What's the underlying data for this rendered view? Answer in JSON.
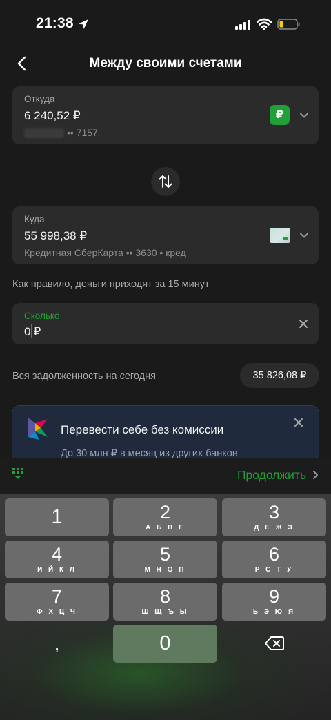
{
  "status_bar": {
    "time": "21:38"
  },
  "header": {
    "title": "Между своими счетами"
  },
  "from_account": {
    "label": "Откуда",
    "amount": "6 240,52 ₽",
    "account_suffix": "•• 7157",
    "badge": "₽"
  },
  "to_account": {
    "label": "Куда",
    "amount": "55 998,38 ₽",
    "details": "Кредитная СберКарта •• 3630 • кред"
  },
  "info_text": "Как правило, деньги приходят за 15 минут",
  "amount_input": {
    "label": "Сколько",
    "value": "0",
    "currency": "₽"
  },
  "debt": {
    "label": "Вся задолженность на сегодня",
    "value": "35 826,08 ₽"
  },
  "promo": {
    "title": "Перевести себе без комиссии",
    "subtitle": "До 30 млн ₽ в месяц из других банков"
  },
  "accessory": {
    "continue_label": "Продолжить"
  },
  "keyboard": {
    "keys": [
      {
        "digit": "1",
        "letters": ""
      },
      {
        "digit": "2",
        "letters": "А Б В Г"
      },
      {
        "digit": "3",
        "letters": "Д Е Ж З"
      },
      {
        "digit": "4",
        "letters": "И Й К Л"
      },
      {
        "digit": "5",
        "letters": "М Н О П"
      },
      {
        "digit": "6",
        "letters": "Р С Т У"
      },
      {
        "digit": "7",
        "letters": "Ф Х Ц Ч"
      },
      {
        "digit": "8",
        "letters": "Ш Щ Ъ Ы"
      },
      {
        "digit": "9",
        "letters": "Ь Э Ю Я"
      }
    ],
    "comma": ",",
    "zero": "0"
  },
  "colors": {
    "accent": "#21a038",
    "background": "#1a1a1a",
    "card": "#2b2b2b"
  }
}
